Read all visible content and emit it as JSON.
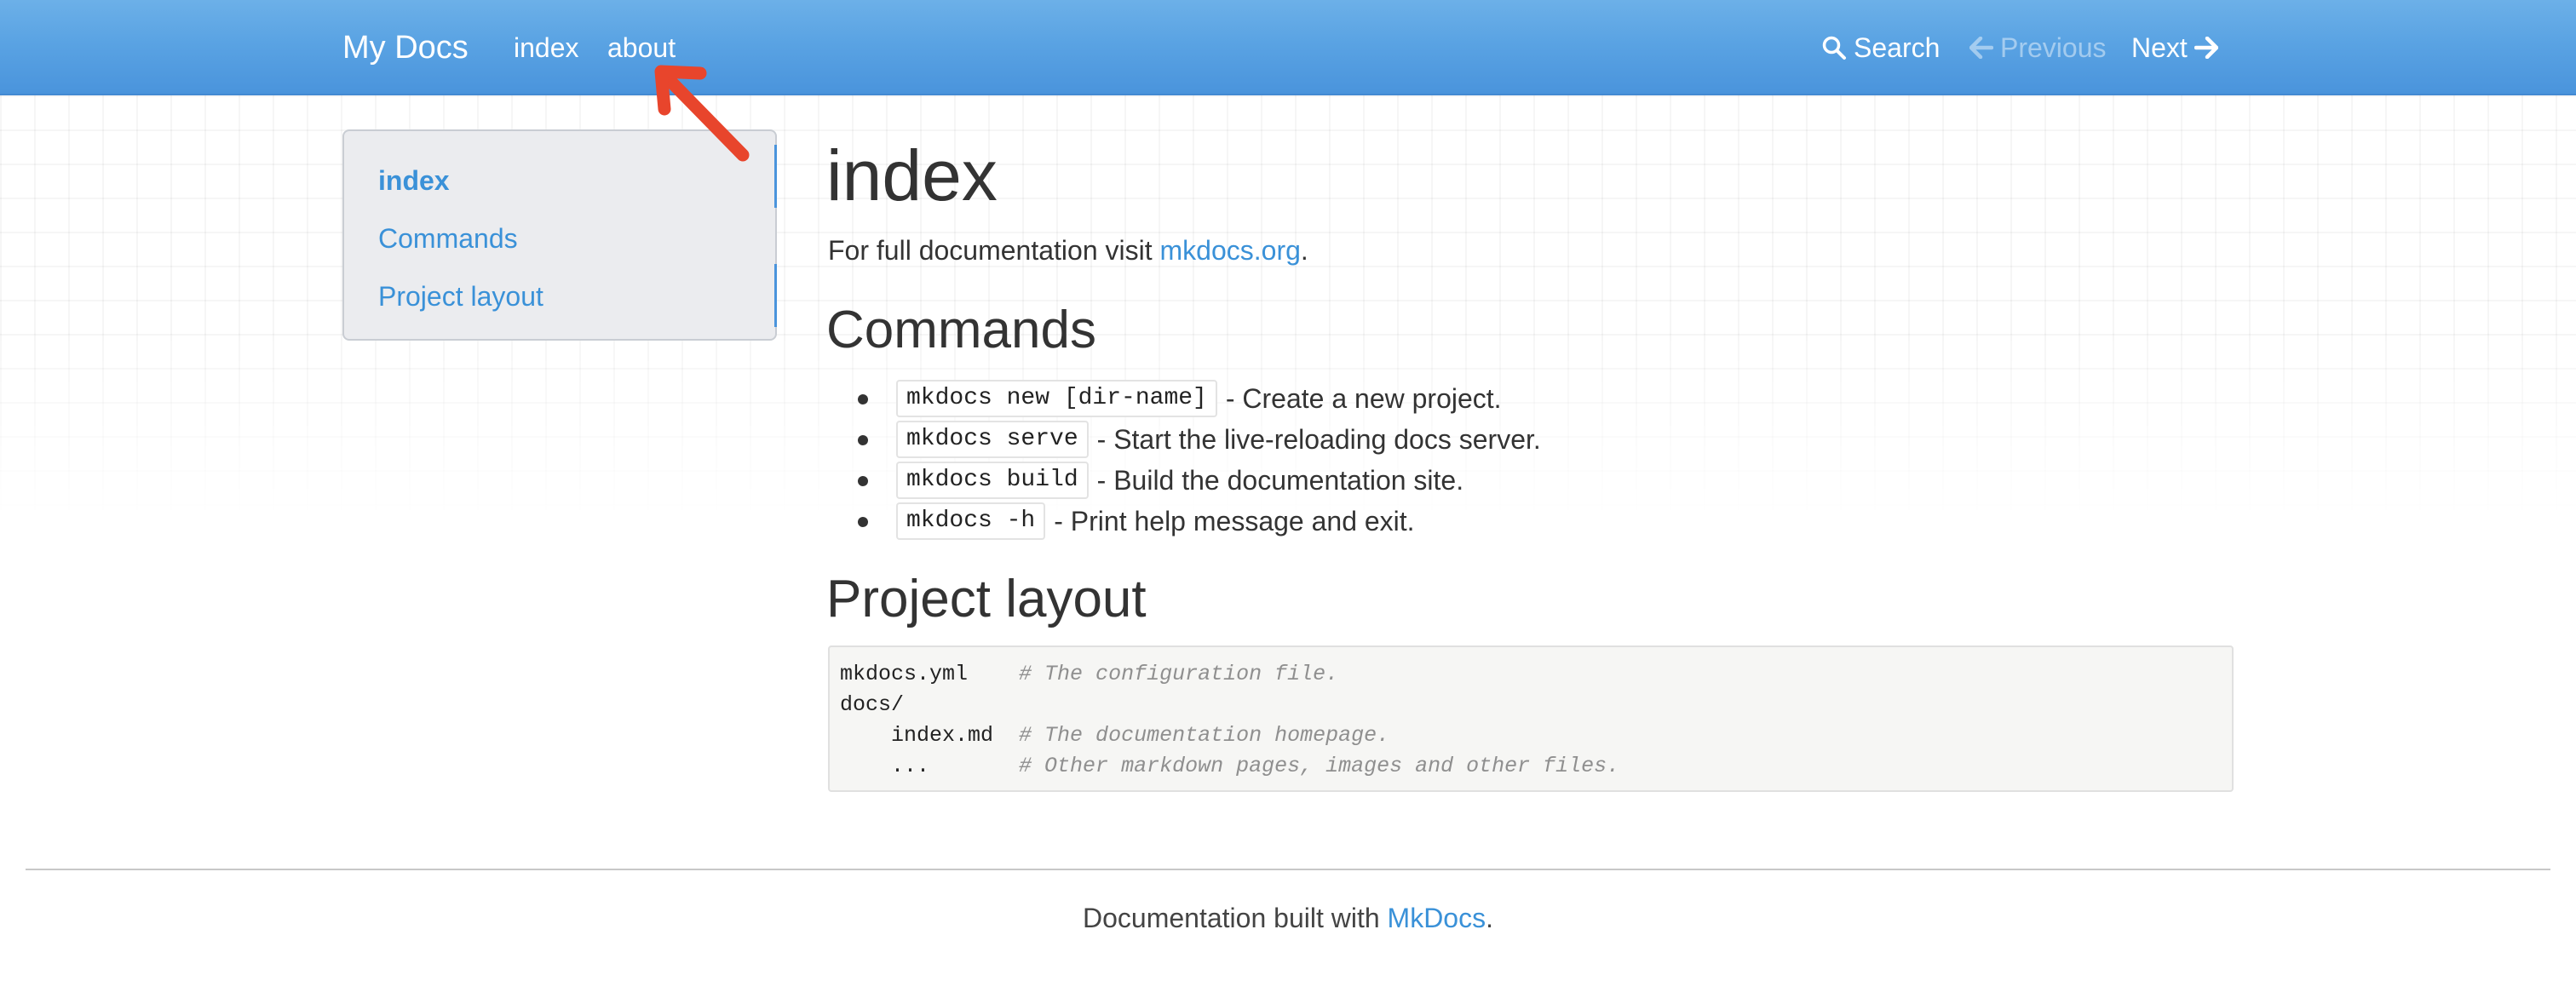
{
  "navbar": {
    "brand": "My Docs",
    "links": [
      "index",
      "about"
    ],
    "search_label": "Search",
    "previous_label": "Previous",
    "next_label": "Next"
  },
  "sidebar": {
    "items": [
      {
        "label": "index",
        "active": true
      },
      {
        "label": "Commands",
        "active": false
      },
      {
        "label": "Project layout",
        "active": false
      }
    ]
  },
  "content": {
    "title": "index",
    "intro_prefix": "For full documentation visit ",
    "intro_link": "mkdocs.org",
    "intro_suffix": ".",
    "commands_heading": "Commands",
    "commands": [
      {
        "code": "mkdocs new [dir-name]",
        "desc": "- Create a new project."
      },
      {
        "code": "mkdocs serve",
        "desc": "- Start the live-reloading docs server."
      },
      {
        "code": "mkdocs build",
        "desc": "- Build the documentation site."
      },
      {
        "code": "mkdocs -h",
        "desc": "- Print help message and exit."
      }
    ],
    "layout_heading": "Project layout",
    "layout_lines": [
      {
        "text": "mkdocs.yml    ",
        "comment": "# The configuration file."
      },
      {
        "text": "docs/",
        "comment": ""
      },
      {
        "text": "    index.md  ",
        "comment": "# The documentation homepage."
      },
      {
        "text": "    ...       ",
        "comment": "# Other markdown pages, images and other files."
      }
    ]
  },
  "footer": {
    "prefix": "Documentation built with ",
    "link": "MkDocs",
    "suffix": "."
  },
  "colors": {
    "navbar": "#4a94dc",
    "link": "#3a91d8",
    "annotation_arrow": "#e8452c"
  }
}
